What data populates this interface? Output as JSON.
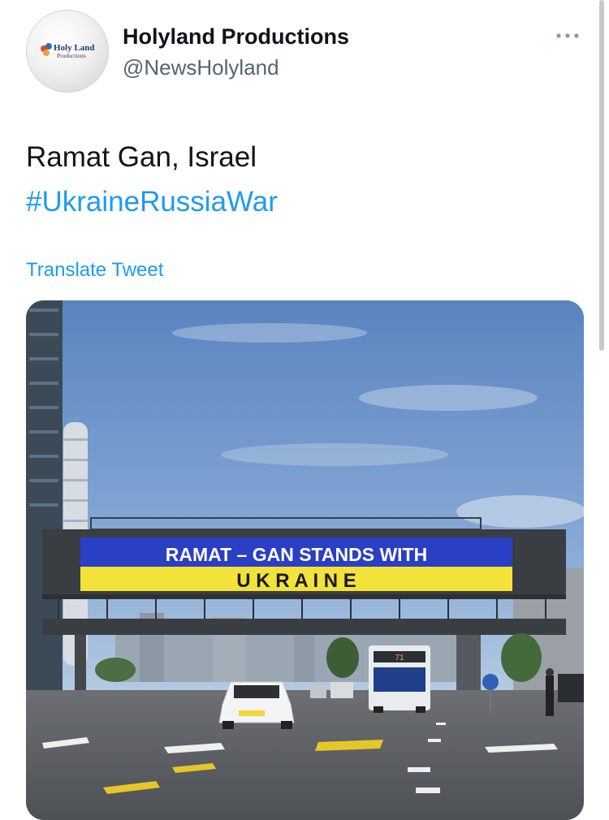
{
  "profile": {
    "avatar_logo_line1": "Holy Land",
    "avatar_logo_line2": "Productions",
    "display_name": "Holyland Productions",
    "handle": "@NewsHolyland"
  },
  "tweet": {
    "text_line1": "Ramat Gan, Israel",
    "hashtag": "#UkraineRussiaWar",
    "translate_label": "Translate Tweet"
  },
  "media": {
    "banner_line1": "RAMAT – GAN STANDS WITH",
    "banner_line2": "U K R A I N E",
    "bus_route": "71"
  },
  "colors": {
    "link": "#1d9bf0",
    "text": "#0f1419",
    "secondary": "#536471",
    "ukraine_blue": "#2a3fc4",
    "ukraine_yellow": "#f2e23a"
  },
  "icons": {
    "more": "more-horizontal-icon"
  }
}
